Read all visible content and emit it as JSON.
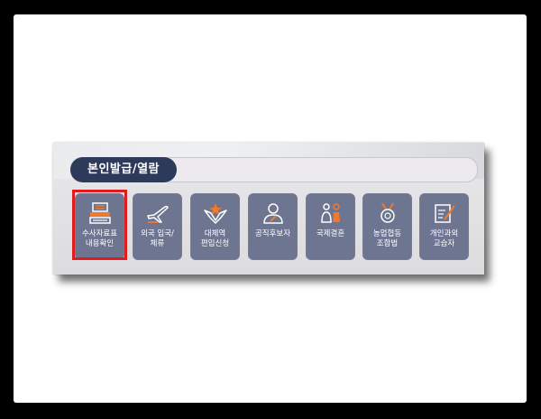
{
  "section": {
    "title": "본인발급/열람"
  },
  "tiles": [
    {
      "label": "수사자료표\n내용확인",
      "icon": "document-list-icon"
    },
    {
      "label": "외국 입국/\n체류",
      "icon": "airplane-icon"
    },
    {
      "label": "대체역\n편입신청",
      "icon": "military-emblem-icon"
    },
    {
      "label": "공직후보자",
      "icon": "person-badge-icon"
    },
    {
      "label": "국제결혼",
      "icon": "couple-icon"
    },
    {
      "label": "농업협동\n조합법",
      "icon": "medal-icon"
    },
    {
      "label": "개인과외\n교습자",
      "icon": "pen-note-icon"
    }
  ],
  "colors": {
    "tile": "#6d7591",
    "accent": "#f07a2a",
    "title_bg": "#2e3a5a",
    "highlight": "#e01c1c"
  }
}
